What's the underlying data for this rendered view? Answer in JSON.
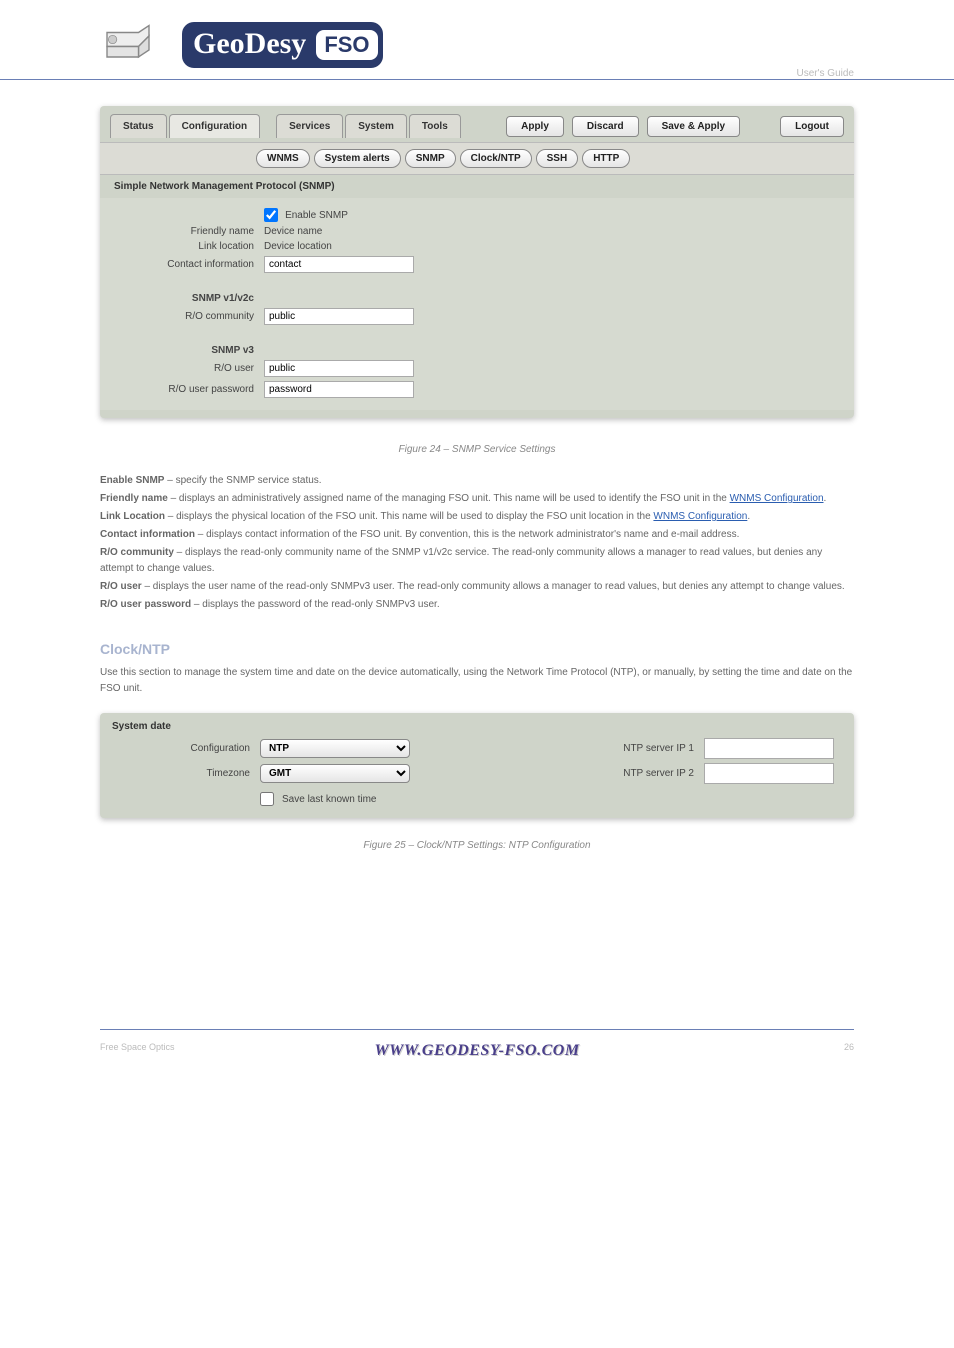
{
  "doc": {
    "brand_main": "GeoDesy",
    "brand_sub": "FSO",
    "subtitle": "User's Guide",
    "footer_left": "Free Space Optics",
    "footer_brand": "WWW.GEODESY-FSO.COM",
    "footer_right": "26"
  },
  "topActions": {
    "apply": "Apply",
    "discard": "Discard",
    "saveApply": "Save & Apply",
    "logout": "Logout"
  },
  "mainTabs": [
    "Status",
    "Configuration",
    "Services",
    "System",
    "Tools"
  ],
  "subTabs": [
    "WNMS",
    "System alerts",
    "SNMP",
    "Clock/NTP",
    "SSH",
    "HTTP"
  ],
  "snmpPanel": {
    "title": "Simple Network Management Protocol (SNMP)",
    "enableLabel": "Enable SNMP",
    "enableChecked": true,
    "friendlyNameLabel": "Friendly name",
    "friendlyNameValue": "Device name",
    "linkLocationLabel": "Link location",
    "linkLocationValue": "Device location",
    "contactLabel": "Contact information",
    "contactValue": "contact",
    "v12cHeader": "SNMP v1/v2c",
    "roCommunityLabel": "R/O community",
    "roCommunityValue": "public",
    "v3Header": "SNMP v3",
    "roUserLabel": "R/O user",
    "roUserValue": "public",
    "roUserPwdLabel": "R/O user password",
    "roUserPwdValue": "password"
  },
  "figCaption": "Figure 24 – SNMP Service Settings",
  "defs": {
    "p1a": "Enable SNMP",
    "p1b": " – specify the SNMP service status.",
    "p2a": "Friendly name",
    "p2b": " – displays an administratively assigned name of the managing FSO unit. This name will be used to identify the FSO unit in the ",
    "p2link": "WNMS Configuration",
    "p2c": ".",
    "p3a": "Link Location",
    "p3b": " – displays the physical location of the FSO unit. This name will be used to display the FSO unit location in the ",
    "p3link": "WNMS Configuration",
    "p3c": ".",
    "p4a": "Contact information",
    "p4b": " – displays contact information of the FSO unit. By convention, this is the network administrator's name and e-mail address.",
    "p5a": "R/O community",
    "p5b": " – displays the read-only community name of the SNMP v1/v2c service. The read-only community allows a manager to read values, but denies any attempt to change values.",
    "p6a": "R/O user",
    "p6b": " – displays the user name of the read-only SNMPv3 user. The read-only community allows a manager to read values, but denies any attempt to change values.",
    "p7a": "R/O user password",
    "p7b": " – displays the password of the read-only SNMPv3 user."
  },
  "clockHeading": "Clock/NTP",
  "clockIntro": "Use this section to manage the system time and date on the device automatically, using the Network Time Protocol (NTP), or manually, by setting the time and date on the FSO unit.",
  "ntpPanel": {
    "title": "System date",
    "configLabel": "Configuration",
    "configValue": "NTP",
    "tzLabel": "Timezone",
    "tzValue": "GMT",
    "saveTimeLabel": "Save last known time",
    "saveTimeChecked": false,
    "ntp1Label": "NTP server IP 1",
    "ntp1Value": "",
    "ntp2Label": "NTP server IP 2",
    "ntp2Value": ""
  },
  "figCaption2": "Figure 25 – Clock/NTP Settings: NTP Configuration"
}
